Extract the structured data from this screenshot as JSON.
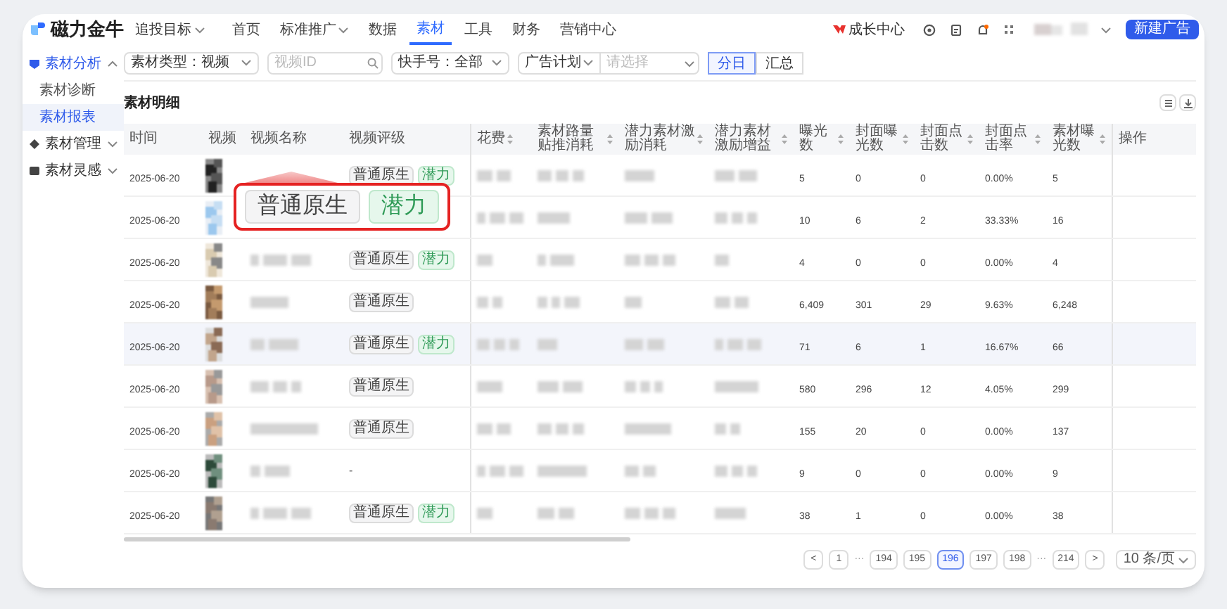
{
  "top_nav": {
    "logo": "磁力金牛",
    "goal_selector": "追投目标",
    "items": [
      {
        "label": "首页",
        "selected": false,
        "dropdown": false
      },
      {
        "label": "标准推广",
        "selected": false,
        "dropdown": true
      },
      {
        "label": "数据",
        "selected": false,
        "dropdown": false
      },
      {
        "label": "素材",
        "selected": true,
        "dropdown": false
      },
      {
        "label": "工具",
        "selected": false,
        "dropdown": false
      },
      {
        "label": "财务",
        "selected": false,
        "dropdown": false
      },
      {
        "label": "营销中心",
        "selected": false,
        "dropdown": false
      }
    ],
    "growth_center": "成长中心",
    "new_ad_button": "新建广告"
  },
  "sidebar": {
    "items": [
      {
        "label": "素材分析",
        "expanded": true,
        "children": [
          {
            "label": "素材诊断",
            "selected": false
          },
          {
            "label": "素材报表",
            "selected": true
          }
        ]
      },
      {
        "label": "素材管理",
        "expanded": false
      },
      {
        "label": "素材灵感",
        "expanded": false
      }
    ]
  },
  "filters": {
    "material_type": "素材类型：视频",
    "video_id": {
      "placeholder": "视频ID"
    },
    "account": "快手号：全部",
    "ad_plan": {
      "label": "广告计划",
      "placeholder": "请选择"
    },
    "granularity": [
      {
        "label": "分日",
        "selected": true
      },
      {
        "label": "汇总",
        "selected": false
      }
    ]
  },
  "section_title": "素材明细",
  "table": {
    "columns": [
      {
        "label": "时间",
        "sortable": false
      },
      {
        "label": "视频",
        "sortable": false
      },
      {
        "label": "视频名称",
        "sortable": false
      },
      {
        "label": "视频评级",
        "sortable": false
      },
      {
        "label": "花费",
        "sortable": true
      },
      {
        "label": "素材路量贴推消耗",
        "sortable": true
      },
      {
        "label": "潜力素材激励消耗",
        "sortable": true
      },
      {
        "label": "潜力素材激励增益",
        "sortable": true
      },
      {
        "label": "曝光数",
        "sortable": true
      },
      {
        "label": "封面曝光数",
        "sortable": true
      },
      {
        "label": "封面点击数",
        "sortable": true
      },
      {
        "label": "封面点击率",
        "sortable": true
      },
      {
        "label": "素材曝光数",
        "sortable": true
      },
      {
        "label": "操作",
        "sortable": false
      }
    ],
    "rows": [
      {
        "time": "2025-06-20",
        "video": {
          "kind": "picture"
        },
        "highlighted": false,
        "rating": [
          {
            "text": "普通原生",
            "kind": "plain"
          },
          {
            "text": "潜力",
            "kind": "potential"
          }
        ],
        "exposure": "5",
        "cover_exposure": "0",
        "cover_clicks": "0",
        "cover_ctr": "0.00%",
        "material_exposure": "5"
      },
      {
        "time": "2025-06-20",
        "video": {
          "kind": "picture"
        },
        "highlighted": false,
        "exposure": "10",
        "cover_exposure": "6",
        "cover_clicks": "2",
        "cover_ctr": "33.33%",
        "material_exposure": "16"
      },
      {
        "time": "2025-06-20",
        "video": {
          "kind": "picture"
        },
        "highlighted": false,
        "rating": [
          {
            "text": "普通原生",
            "kind": "plain"
          },
          {
            "text": "潜力",
            "kind": "potential"
          }
        ],
        "exposure": "4",
        "cover_exposure": "0",
        "cover_clicks": "0",
        "cover_ctr": "0.00%",
        "material_exposure": "4"
      },
      {
        "time": "2025-06-20",
        "video": {
          "kind": "picture"
        },
        "highlighted": false,
        "rating": [
          {
            "text": "普通原生",
            "kind": "plain"
          }
        ],
        "exposure": "6,409",
        "cover_exposure": "301",
        "cover_clicks": "29",
        "cover_ctr": "9.63%",
        "material_exposure": "6,248"
      },
      {
        "time": "2025-06-20",
        "video": {
          "kind": "picture"
        },
        "highlighted": true,
        "rating": [
          {
            "text": "普通原生",
            "kind": "plain"
          },
          {
            "text": "潜力",
            "kind": "potential"
          }
        ],
        "exposure": "71",
        "cover_exposure": "6",
        "cover_clicks": "1",
        "cover_ctr": "16.67%",
        "material_exposure": "66"
      },
      {
        "time": "2025-06-20",
        "video": {
          "kind": "picture"
        },
        "highlighted": false,
        "rating": [
          {
            "text": "普通原生",
            "kind": "plain"
          }
        ],
        "exposure": "580",
        "cover_exposure": "296",
        "cover_clicks": "12",
        "cover_ctr": "4.05%",
        "material_exposure": "299"
      },
      {
        "time": "2025-06-20",
        "video": {
          "kind": "picture"
        },
        "highlighted": false,
        "rating": [
          {
            "text": "普通原生",
            "kind": "plain"
          }
        ],
        "exposure": "155",
        "cover_exposure": "20",
        "cover_clicks": "0",
        "cover_ctr": "0.00%",
        "material_exposure": "137"
      },
      {
        "time": "2025-06-20",
        "video": {
          "kind": "picture"
        },
        "highlighted": false,
        "rating_text": "-",
        "exposure": "9",
        "cover_exposure": "0",
        "cover_clicks": "0",
        "cover_ctr": "0.00%",
        "material_exposure": "9"
      },
      {
        "time": "2025-06-20",
        "video": {
          "kind": "picture"
        },
        "highlighted": false,
        "rating": [
          {
            "text": "普通原生",
            "kind": "plain"
          },
          {
            "text": "潜力",
            "kind": "potential"
          }
        ],
        "exposure": "38",
        "cover_exposure": "1",
        "cover_clicks": "0",
        "cover_ctr": "0.00%",
        "material_exposure": "38"
      }
    ]
  },
  "callout": {
    "tags": [
      {
        "text": "普通原生",
        "kind": "plain"
      },
      {
        "text": "潜力",
        "kind": "potential"
      }
    ]
  },
  "pagination": {
    "prev": "<",
    "next": ">",
    "pages": [
      {
        "label": "1",
        "kind": "page",
        "selected": false
      },
      {
        "label": "···",
        "kind": "ellipsis"
      },
      {
        "label": "194",
        "kind": "page",
        "selected": false
      },
      {
        "label": "195",
        "kind": "page",
        "selected": false
      },
      {
        "label": "196",
        "kind": "page",
        "selected": true
      },
      {
        "label": "197",
        "kind": "page",
        "selected": false
      },
      {
        "label": "198",
        "kind": "page",
        "selected": false
      },
      {
        "label": "···",
        "kind": "ellipsis"
      },
      {
        "label": "214",
        "kind": "page",
        "selected": false
      }
    ],
    "page_size": "10 条/页"
  }
}
